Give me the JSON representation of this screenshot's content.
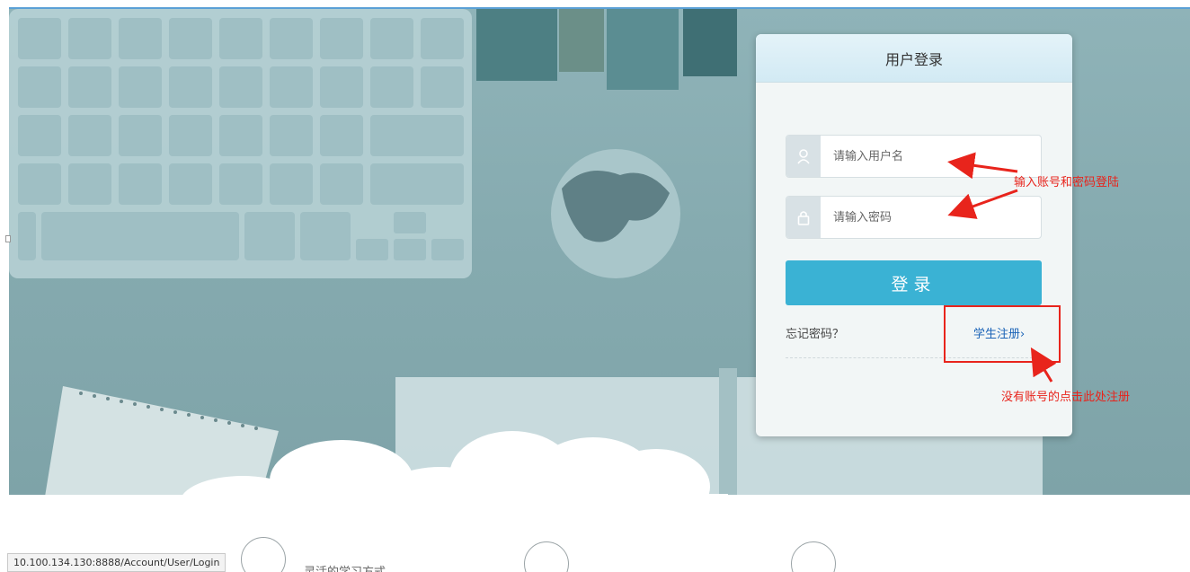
{
  "login_card": {
    "title": "用户登录",
    "username_placeholder": "请输入用户名",
    "password_placeholder": "请输入密码",
    "login_label": "登录",
    "forgot_label": "忘记密码？",
    "register_label": "学生注册›"
  },
  "annotations": {
    "login_hint": "输入账号和密码登陆",
    "register_hint": "没有账号的点击此处注册"
  },
  "features": [
    {
      "icon": "book-icon",
      "label": "灵活的学习方式"
    },
    {
      "icon": "clipboard-icon",
      "label": ""
    },
    {
      "icon": "chat-icon",
      "label": ""
    }
  ],
  "status_bar": {
    "url": "10.100.134.130:8888/Account/User/Login"
  },
  "colors": {
    "accent": "#3ab2d4",
    "annotation": "#e8241c",
    "link": "#1a63b7"
  }
}
